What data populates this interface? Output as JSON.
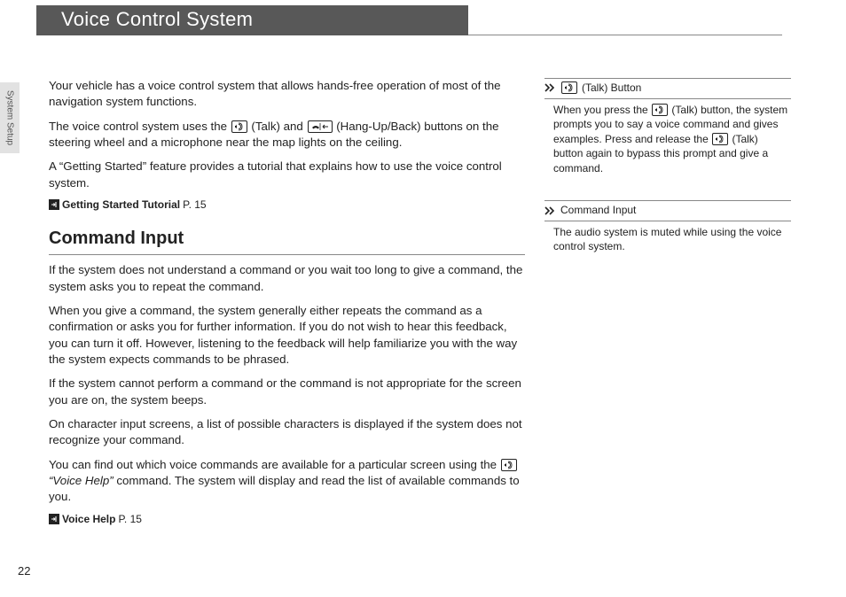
{
  "header": {
    "title": "Voice Control System"
  },
  "side_tab": "System Setup",
  "main": {
    "intro_p1": "Your vehicle has a voice control system that allows hands-free operation of most of the navigation system functions.",
    "intro_p2a": "The voice control system uses the ",
    "intro_p2b": " (Talk) and ",
    "intro_p2c": " (Hang-Up/Back) buttons on the steering wheel and a microphone near the map lights on the ceiling.",
    "intro_p3": "A “Getting Started” feature provides a tutorial that explains how to use the voice control system.",
    "ref1_label": "Getting Started Tutorial",
    "ref1_page": "P. 15",
    "section_heading": "Command Input",
    "ci_p1": "If the system does not understand a command or you wait too long to give a command, the system asks you to repeat the command.",
    "ci_p2": "When you give a command, the system generally either repeats the command as a confirmation or asks you for further information. If you do not wish to hear this feedback, you can turn it off. However, listening to the feedback will help familiarize you with the way the system expects commands to be phrased.",
    "ci_p3": "If the system cannot perform a command or the command is not appropriate for the screen you are on, the system beeps.",
    "ci_p4": "On character input screens, a list of possible characters is displayed if the system does not recognize your command.",
    "ci_p5a": "You can find out which voice commands are available for a particular screen using the ",
    "ci_p5b": " “Voice Help”",
    "ci_p5c": " command. The system will display and read the list of available commands to you.",
    "ref2_label": "Voice Help",
    "ref2_page": "P. 15"
  },
  "sidebar": {
    "note1_title": " (Talk) Button",
    "note1_body_a": "When you press the ",
    "note1_body_b": " (Talk) button, the system prompts you to say a voice command and gives examples. Press and release the ",
    "note1_body_c": " (Talk) button again to bypass this prompt and give a command.",
    "note2_title": "Command Input",
    "note2_body": "The audio system is muted while using the voice control system."
  },
  "page_number": "22"
}
